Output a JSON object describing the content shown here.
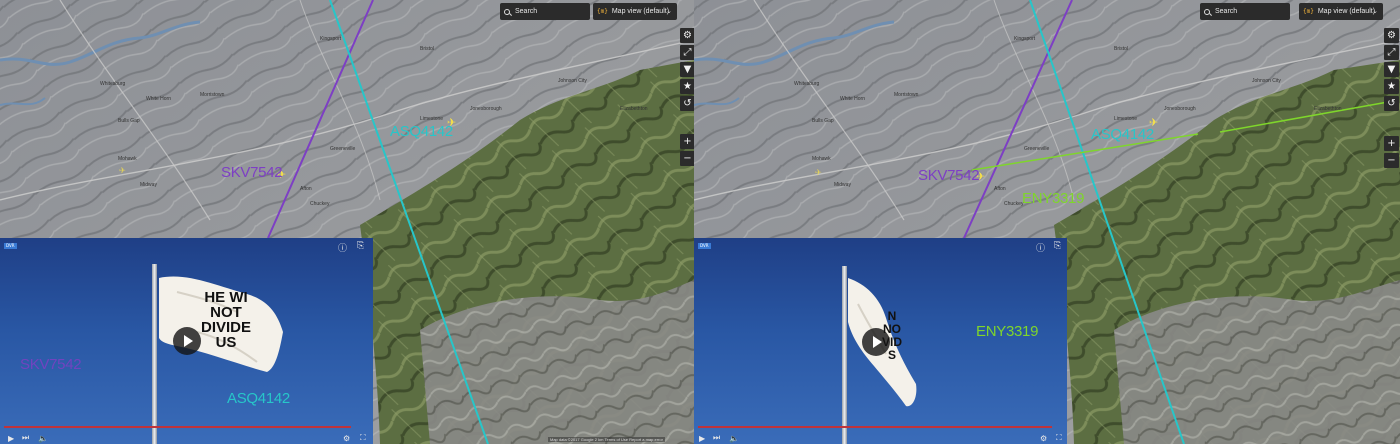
{
  "colors": {
    "skv": "#7d3fc4",
    "asq": "#27c6c9",
    "eny": "#7fd62b",
    "plane": "#f5e04a"
  },
  "left": {
    "search_placeholder": "Search",
    "map_view_icon": "{m}",
    "map_view_label": "Map view (default)",
    "tools": [
      "gear-icon",
      "expand-icon",
      "filter-icon",
      "star-icon",
      "history-icon"
    ],
    "zoom_in": "+",
    "zoom_out": "−",
    "callsigns": {
      "skv": "SKV7542",
      "asq": "ASQ4142"
    },
    "places": [
      "Johnson City",
      "Kingsport",
      "Greeneville",
      "Morristown",
      "Bulls Gap",
      "White Horn",
      "Whitesburg",
      "Mohawk",
      "Midway",
      "Afton",
      "Chuckey",
      "Limestone",
      "Jonesborough",
      "Bristol",
      "Elizabethton"
    ],
    "video": {
      "logo": "DVR",
      "flag_lines": [
        "HE WI",
        "NOT",
        "DIVIDE",
        "US"
      ],
      "overlay_skv": "SKV7542",
      "overlay_asq": "ASQ4142",
      "progress": 0.95
    },
    "attribution": "Map data ©2017 Google  2 km  Terms of Use  Report a map error"
  },
  "right": {
    "search_placeholder": "Search",
    "map_view_icon": "{m}",
    "map_view_label": "Map view (default)",
    "tools": [
      "gear-icon",
      "expand-icon",
      "filter-icon",
      "star-icon",
      "history-icon"
    ],
    "zoom_in": "+",
    "zoom_out": "−",
    "callsigns": {
      "skv": "SKV7542",
      "asq": "ASQ4142",
      "eny": "ENY3319"
    },
    "places": [
      "Johnson City",
      "Kingsport",
      "Greeneville",
      "Morristown",
      "Bulls Gap",
      "White Horn",
      "Whitesburg",
      "Mohawk",
      "Midway",
      "Afton",
      "Chuckey",
      "Limestone",
      "Jonesborough",
      "Bristol",
      "Elizabethton"
    ],
    "video": {
      "logo": "DVR",
      "flag_lines": [
        "N",
        "NO",
        "VID",
        "S"
      ],
      "overlay_eny": "ENY3319",
      "progress": 0.97
    }
  }
}
